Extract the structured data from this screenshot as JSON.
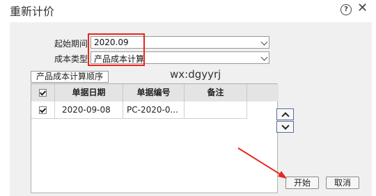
{
  "dialog": {
    "title": "重新计价",
    "help_glyph": "?",
    "close_glyph": "✕"
  },
  "form": {
    "start_period_label": "起始期间",
    "start_period_value": "2020.09",
    "cost_type_label": "成本类型",
    "cost_type_value": "产品成本计算"
  },
  "tab": {
    "label": "产品成本计算顺序"
  },
  "watermark": "wx:dgyyrj",
  "table": {
    "columns": [
      "单据日期",
      "单据编号",
      "备注"
    ],
    "rows": [
      {
        "checked": true,
        "date": "2020-09-08",
        "number": "PC-2020-0...",
        "note": ""
      }
    ]
  },
  "buttons": {
    "start": "开始",
    "cancel": "取消"
  },
  "annotation_colors": {
    "highlight": "#e8261c"
  }
}
